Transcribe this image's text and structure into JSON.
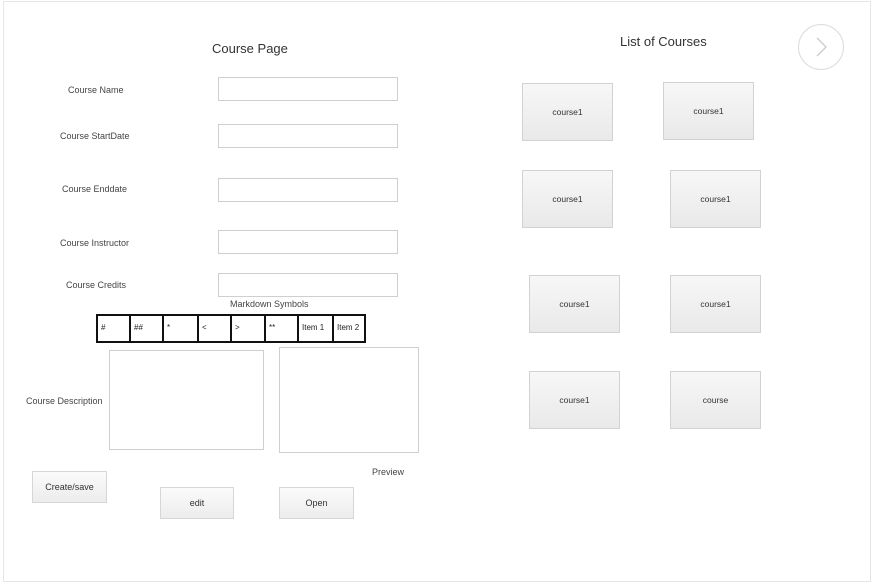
{
  "form": {
    "title": "Course Page",
    "labels": {
      "name": "Course Name",
      "start": "Course StartDate",
      "end": "Course Enddate",
      "instructor": "Course Instructor",
      "credits": "Course Credits",
      "description": "Course Description"
    },
    "fields": {
      "name": "",
      "start": "",
      "end": "",
      "instructor": "",
      "credits": "",
      "description": ""
    },
    "markdown_title": "Markdown Symbols",
    "markdown_symbols": [
      "#",
      "##",
      "*",
      "<",
      ">",
      "**",
      "Item 1",
      "Item 2"
    ],
    "preview_label": "Preview",
    "buttons": {
      "create": "Create/save",
      "edit": "edit",
      "open": "Open"
    }
  },
  "list": {
    "title": "List of Courses",
    "courses": [
      "course1",
      "course1",
      "course1",
      "course1",
      "course1",
      "course1",
      "course1",
      "course"
    ]
  },
  "nav": {
    "next_icon": "chevron-right-icon"
  }
}
